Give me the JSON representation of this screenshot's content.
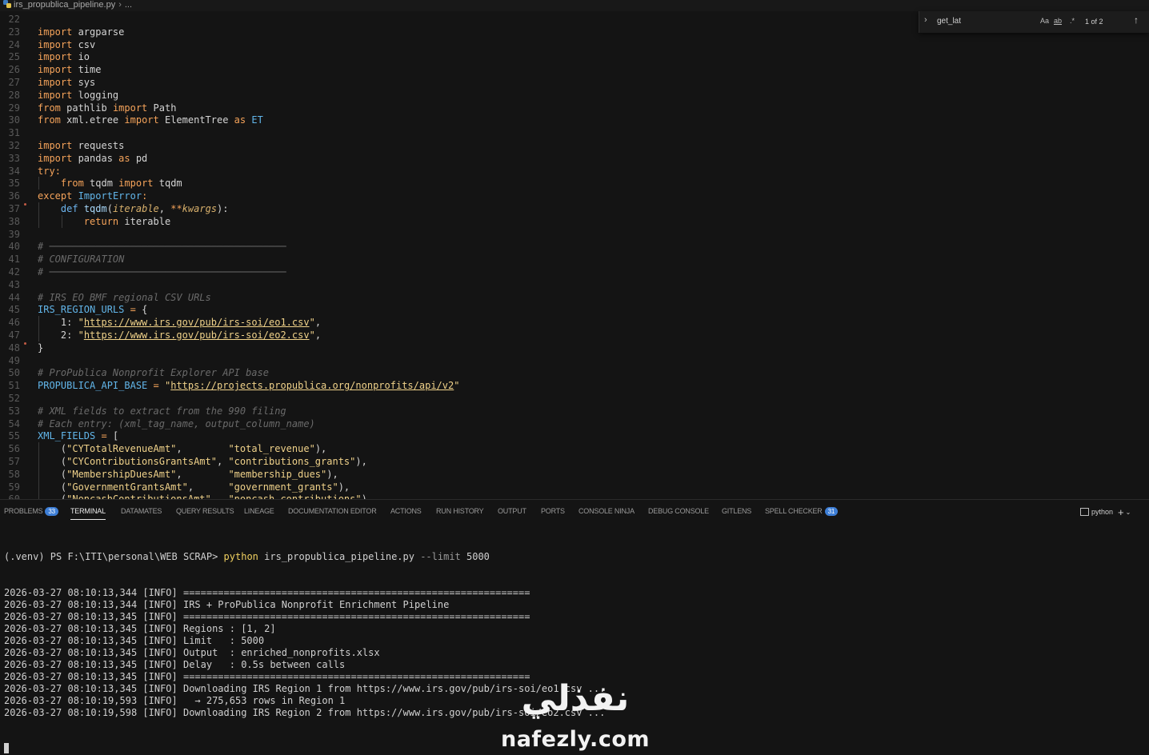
{
  "breadcrumb": {
    "file": "irs_propublica_pipeline.py",
    "rest": "..."
  },
  "find_widget": {
    "query": "get_lat",
    "match_case": "Aa",
    "whole_word": "ab",
    "regex": ".*",
    "count": "1 of 2"
  },
  "editor": {
    "lines": [
      {
        "n": "22",
        "t": []
      },
      {
        "n": "23",
        "t": [
          [
            "kw",
            "import"
          ],
          [
            "",
            " argparse"
          ]
        ]
      },
      {
        "n": "24",
        "t": [
          [
            "kw",
            "import"
          ],
          [
            "",
            " csv"
          ]
        ]
      },
      {
        "n": "25",
        "t": [
          [
            "kw",
            "import"
          ],
          [
            "",
            " io"
          ]
        ]
      },
      {
        "n": "26",
        "t": [
          [
            "kw",
            "import"
          ],
          [
            "",
            " time"
          ]
        ]
      },
      {
        "n": "27",
        "t": [
          [
            "kw",
            "import"
          ],
          [
            "",
            " sys"
          ]
        ]
      },
      {
        "n": "28",
        "t": [
          [
            "kw",
            "import"
          ],
          [
            "",
            " logging"
          ]
        ]
      },
      {
        "n": "29",
        "t": [
          [
            "kw",
            "from"
          ],
          [
            "",
            " pathlib "
          ],
          [
            "kw",
            "import"
          ],
          [
            "",
            " Path"
          ]
        ]
      },
      {
        "n": "30",
        "t": [
          [
            "kw",
            "from"
          ],
          [
            "",
            " xml.etree "
          ],
          [
            "kw",
            "import"
          ],
          [
            "",
            " ElementTree "
          ],
          [
            "kw",
            "as"
          ],
          [
            "",
            " "
          ],
          [
            "const",
            "ET"
          ]
        ]
      },
      {
        "n": "31",
        "t": []
      },
      {
        "n": "32",
        "t": [
          [
            "kw",
            "import"
          ],
          [
            "",
            " requests"
          ]
        ]
      },
      {
        "n": "33",
        "t": [
          [
            "kw",
            "import"
          ],
          [
            "",
            " pandas "
          ],
          [
            "kw",
            "as"
          ],
          [
            "",
            " pd"
          ]
        ]
      },
      {
        "n": "34",
        "t": [
          [
            "kw",
            "try"
          ],
          [
            "op",
            ":"
          ]
        ]
      },
      {
        "n": "35",
        "t": [
          [
            "",
            "    "
          ],
          [
            "kw",
            "from"
          ],
          [
            "",
            " tqdm "
          ],
          [
            "kw",
            "import"
          ],
          [
            "",
            " tqdm"
          ]
        ]
      },
      {
        "n": "36",
        "t": [
          [
            "kw",
            "except"
          ],
          [
            "",
            " "
          ],
          [
            "const",
            "ImportError"
          ],
          [
            "op",
            ":"
          ]
        ]
      },
      {
        "n": "37",
        "t": [
          [
            "",
            "    "
          ],
          [
            "kw2",
            "def"
          ],
          [
            "",
            " "
          ],
          [
            "fn",
            "tqdm"
          ],
          [
            "",
            "("
          ],
          [
            "param",
            "iterable"
          ],
          [
            "",
            ", "
          ],
          [
            "op",
            "**"
          ],
          [
            "param",
            "kwargs"
          ],
          [
            "",
            "):"
          ]
        ]
      },
      {
        "n": "38",
        "t": [
          [
            "",
            "        "
          ],
          [
            "kw",
            "return"
          ],
          [
            "",
            " iterable"
          ]
        ]
      },
      {
        "n": "39",
        "t": []
      },
      {
        "n": "40",
        "t": [
          [
            "cm",
            "# ─────────────────────────────────────────"
          ]
        ]
      },
      {
        "n": "41",
        "t": [
          [
            "cm",
            "# CONFIGURATION"
          ]
        ]
      },
      {
        "n": "42",
        "t": [
          [
            "cm",
            "# ─────────────────────────────────────────"
          ]
        ]
      },
      {
        "n": "43",
        "t": []
      },
      {
        "n": "44",
        "t": [
          [
            "cm",
            "# IRS EO BMF regional CSV URLs"
          ]
        ]
      },
      {
        "n": "45",
        "t": [
          [
            "const",
            "IRS_REGION_URLS"
          ],
          [
            "",
            " "
          ],
          [
            "op",
            "="
          ],
          [
            "",
            " {"
          ]
        ]
      },
      {
        "n": "46",
        "t": [
          [
            "",
            "    1: "
          ],
          [
            "str",
            "\""
          ],
          [
            "url",
            "https://www.irs.gov/pub/irs-soi/eo1.csv"
          ],
          [
            "str",
            "\""
          ],
          [
            "",
            ","
          ]
        ]
      },
      {
        "n": "47",
        "t": [
          [
            "",
            "    2: "
          ],
          [
            "str",
            "\""
          ],
          [
            "url",
            "https://www.irs.gov/pub/irs-soi/eo2.csv"
          ],
          [
            "str",
            "\""
          ],
          [
            "",
            ","
          ]
        ]
      },
      {
        "n": "48",
        "t": [
          [
            "",
            "}"
          ]
        ]
      },
      {
        "n": "49",
        "t": []
      },
      {
        "n": "50",
        "t": [
          [
            "cm",
            "# ProPublica Nonprofit Explorer API base"
          ]
        ]
      },
      {
        "n": "51",
        "t": [
          [
            "const",
            "PROPUBLICA_API_BASE"
          ],
          [
            "",
            " "
          ],
          [
            "op",
            "="
          ],
          [
            "",
            " "
          ],
          [
            "str",
            "\""
          ],
          [
            "url",
            "https://projects.propublica.org/nonprofits/api/v2"
          ],
          [
            "str",
            "\""
          ]
        ]
      },
      {
        "n": "52",
        "t": []
      },
      {
        "n": "53",
        "t": [
          [
            "cm",
            "# XML fields to extract from the 990 filing"
          ]
        ]
      },
      {
        "n": "54",
        "t": [
          [
            "cm",
            "# Each entry: (xml_tag_name, output_column_name)"
          ]
        ]
      },
      {
        "n": "55",
        "t": [
          [
            "const",
            "XML_FIELDS"
          ],
          [
            "",
            " "
          ],
          [
            "op",
            "="
          ],
          [
            "",
            " ["
          ]
        ]
      },
      {
        "n": "56",
        "t": [
          [
            "",
            "    ("
          ],
          [
            "str",
            "\"CYTotalRevenueAmt\""
          ],
          [
            "",
            ",        "
          ],
          [
            "str",
            "\"total_revenue\""
          ],
          [
            "",
            "),"
          ]
        ]
      },
      {
        "n": "57",
        "t": [
          [
            "",
            "    ("
          ],
          [
            "str",
            "\"CYContributionsGrantsAmt\""
          ],
          [
            "",
            ", "
          ],
          [
            "str",
            "\"contributions_grants\""
          ],
          [
            "",
            "),"
          ]
        ]
      },
      {
        "n": "58",
        "t": [
          [
            "",
            "    ("
          ],
          [
            "str",
            "\"MembershipDuesAmt\""
          ],
          [
            "",
            ",        "
          ],
          [
            "str",
            "\"membership_dues\""
          ],
          [
            "",
            "),"
          ]
        ]
      },
      {
        "n": "59",
        "t": [
          [
            "",
            "    ("
          ],
          [
            "str",
            "\"GovernmentGrantsAmt\""
          ],
          [
            "",
            ",      "
          ],
          [
            "str",
            "\"government_grants\""
          ],
          [
            "",
            "),"
          ]
        ]
      },
      {
        "n": "60",
        "t": [
          [
            "",
            "    ("
          ],
          [
            "str",
            "\"NoncashContributionsAmt\""
          ],
          [
            "",
            ",  "
          ],
          [
            "str",
            "\"noncash_contributions\""
          ],
          [
            "",
            "),"
          ]
        ]
      }
    ]
  },
  "panel": {
    "tabs": [
      {
        "label": "PROBLEMS",
        "badge": "33"
      },
      {
        "label": "TERMINAL",
        "active": true
      },
      {
        "label": "DATAMATES"
      },
      {
        "label": "QUERY RESULTS"
      },
      {
        "label": "LINEAGE"
      },
      {
        "label": "DOCUMENTATION EDITOR"
      },
      {
        "label": "ACTIONS"
      },
      {
        "label": "RUN HISTORY"
      },
      {
        "label": "OUTPUT"
      },
      {
        "label": "PORTS"
      },
      {
        "label": "CONSOLE NINJA"
      },
      {
        "label": "DEBUG CONSOLE"
      },
      {
        "label": "GITLENS"
      },
      {
        "label": "SPELL CHECKER",
        "badge": "31"
      }
    ],
    "terminal_name": "python",
    "terminal": {
      "prompt": "(.venv) PS F:\\ITI\\personal\\WEB SCRAP> ",
      "cmd_exe": "python",
      "cmd_file": " irs_propublica_pipeline.py ",
      "cmd_flag": "--limit",
      "cmd_val": " 5000",
      "lines": [
        "2026-03-27 08:10:13,344 [INFO] ============================================================",
        "2026-03-27 08:10:13,344 [INFO] IRS + ProPublica Nonprofit Enrichment Pipeline",
        "2026-03-27 08:10:13,345 [INFO] ============================================================",
        "2026-03-27 08:10:13,345 [INFO] Regions : [1, 2]",
        "2026-03-27 08:10:13,345 [INFO] Limit   : 5000",
        "2026-03-27 08:10:13,345 [INFO] Output  : enriched_nonprofits.xlsx",
        "2026-03-27 08:10:13,345 [INFO] Delay   : 0.5s between calls",
        "2026-03-27 08:10:13,345 [INFO] ============================================================",
        "2026-03-27 08:10:13,345 [INFO] Downloading IRS Region 1 from https://www.irs.gov/pub/irs-soi/eo1.csv ...",
        "2026-03-27 08:10:19,593 [INFO]   → 275,653 rows in Region 1",
        "2026-03-27 08:10:19,598 [INFO] Downloading IRS Region 2 from https://www.irs.gov/pub/irs-soi/eo2.csv ..."
      ]
    }
  },
  "watermark": {
    "arabic": "نفذلي",
    "latin": "nafezly.com"
  }
}
